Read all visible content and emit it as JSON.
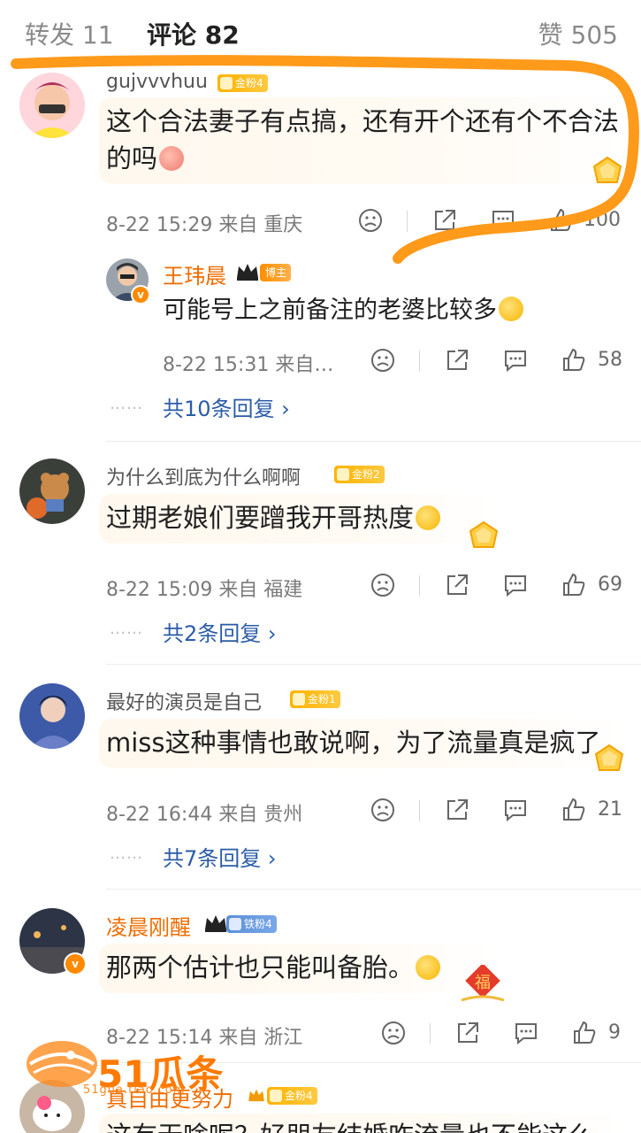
{
  "tabs": {
    "repost": "转发 11",
    "comment": "评论 82",
    "like": "赞 505"
  },
  "comments": [
    {
      "username": "gujvvvhuu",
      "badge": "金粉4",
      "text": "这个合法妻子有点搞，还有开个还有个不合法的吗",
      "time_location": "8-22 15:29 来自 重庆",
      "likes": "100",
      "reply": {
        "username": "王玮晨",
        "badge": "博主",
        "text": "可能号上之前备注的老婆比较多",
        "time_location": "8-22 15:31 来自…",
        "likes": "58"
      },
      "more_replies": "共10条回复 ›"
    },
    {
      "username": "为什么到底为什么啊啊",
      "badge": "金粉2",
      "text": "过期老娘们要蹭我开哥热度",
      "time_location": "8-22 15:09 来自 福建",
      "likes": "69",
      "more_replies": "共2条回复 ›"
    },
    {
      "username": "最好的演员是自己",
      "badge": "金粉1",
      "text": "miss这种事情也敢说啊，为了流量真是疯了",
      "time_location": "8-22 16:44 来自 贵州",
      "likes": "21",
      "more_replies": "共7条回复 ›"
    },
    {
      "username": "凌晨刚醒",
      "badge": "铁粉4",
      "text": "那两个估计也只能叫备胎。",
      "time_location": "8-22 15:14 来自 浙江",
      "likes": "9"
    },
    {
      "username": "真自由更努力",
      "badge": "金粉4",
      "text": "这有无啥呢？好朋友结婚咋流量也不能这么"
    }
  ],
  "reply_dots": "……",
  "watermark": {
    "text": "51瓜条",
    "url": "51gua.tiao.com"
  },
  "colors": {
    "accent_orange": "#ef6c00",
    "link_blue": "#2a5ca8",
    "scribble": "#ff9a1a"
  }
}
